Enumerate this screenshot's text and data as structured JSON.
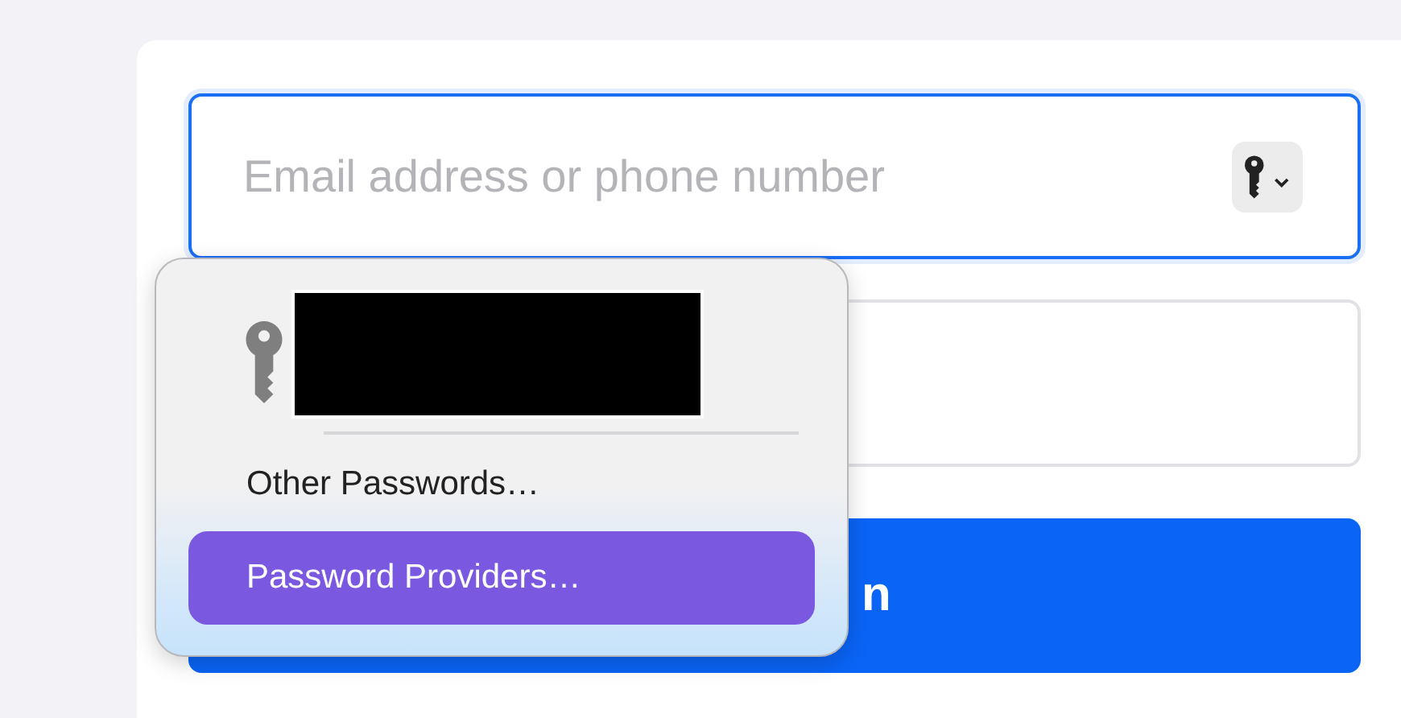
{
  "email_field": {
    "placeholder": "Email address or phone number"
  },
  "login_button": {
    "label": "n"
  },
  "autofill_menu": {
    "items": [
      {
        "label": "Other Passwords…",
        "selected": false
      },
      {
        "label": "Password Providers…",
        "selected": true
      }
    ]
  }
}
